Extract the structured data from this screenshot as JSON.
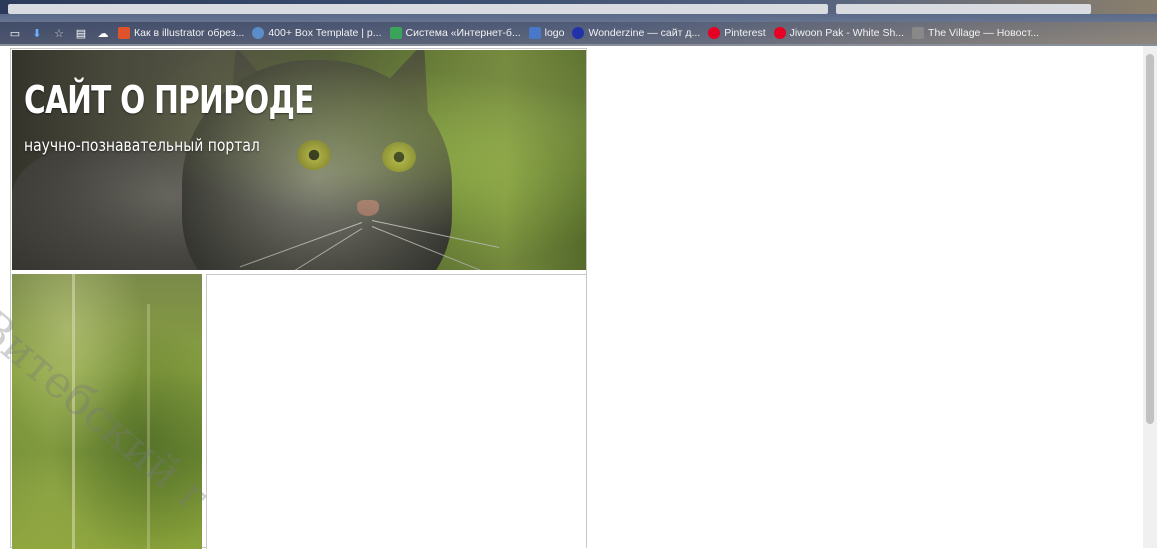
{
  "browser": {
    "bookmarks": [
      {
        "label": "Как в illustrator обрез...",
        "icon": "illustrator-icon",
        "color": "#e0522a"
      },
      {
        "label": "400+ Box Template | p...",
        "icon": "box-template-icon",
        "color": "#5b8ec8"
      },
      {
        "label": "Система «Интернет-б...",
        "icon": "bank-icon",
        "color": "#3aa55a"
      },
      {
        "label": "logo",
        "icon": "logo-icon",
        "color": "#4a78c8"
      },
      {
        "label": "Wonderzine — сайт д...",
        "icon": "wonderzine-icon",
        "color": "#2233aa"
      },
      {
        "label": "Pinterest",
        "icon": "pinterest-icon",
        "color": "#e60023"
      },
      {
        "label": "Jiwoon Pak - White Sh...",
        "icon": "pinterest-icon",
        "color": "#e60023"
      },
      {
        "label": "The Village — Новост...",
        "icon": "village-icon",
        "color": "#888888"
      }
    ]
  },
  "hero": {
    "title": "САЙТ О ПРИРОДЕ",
    "subtitle": "научно-познавательный портал"
  },
  "watermark": {
    "text": "Витебский г"
  }
}
